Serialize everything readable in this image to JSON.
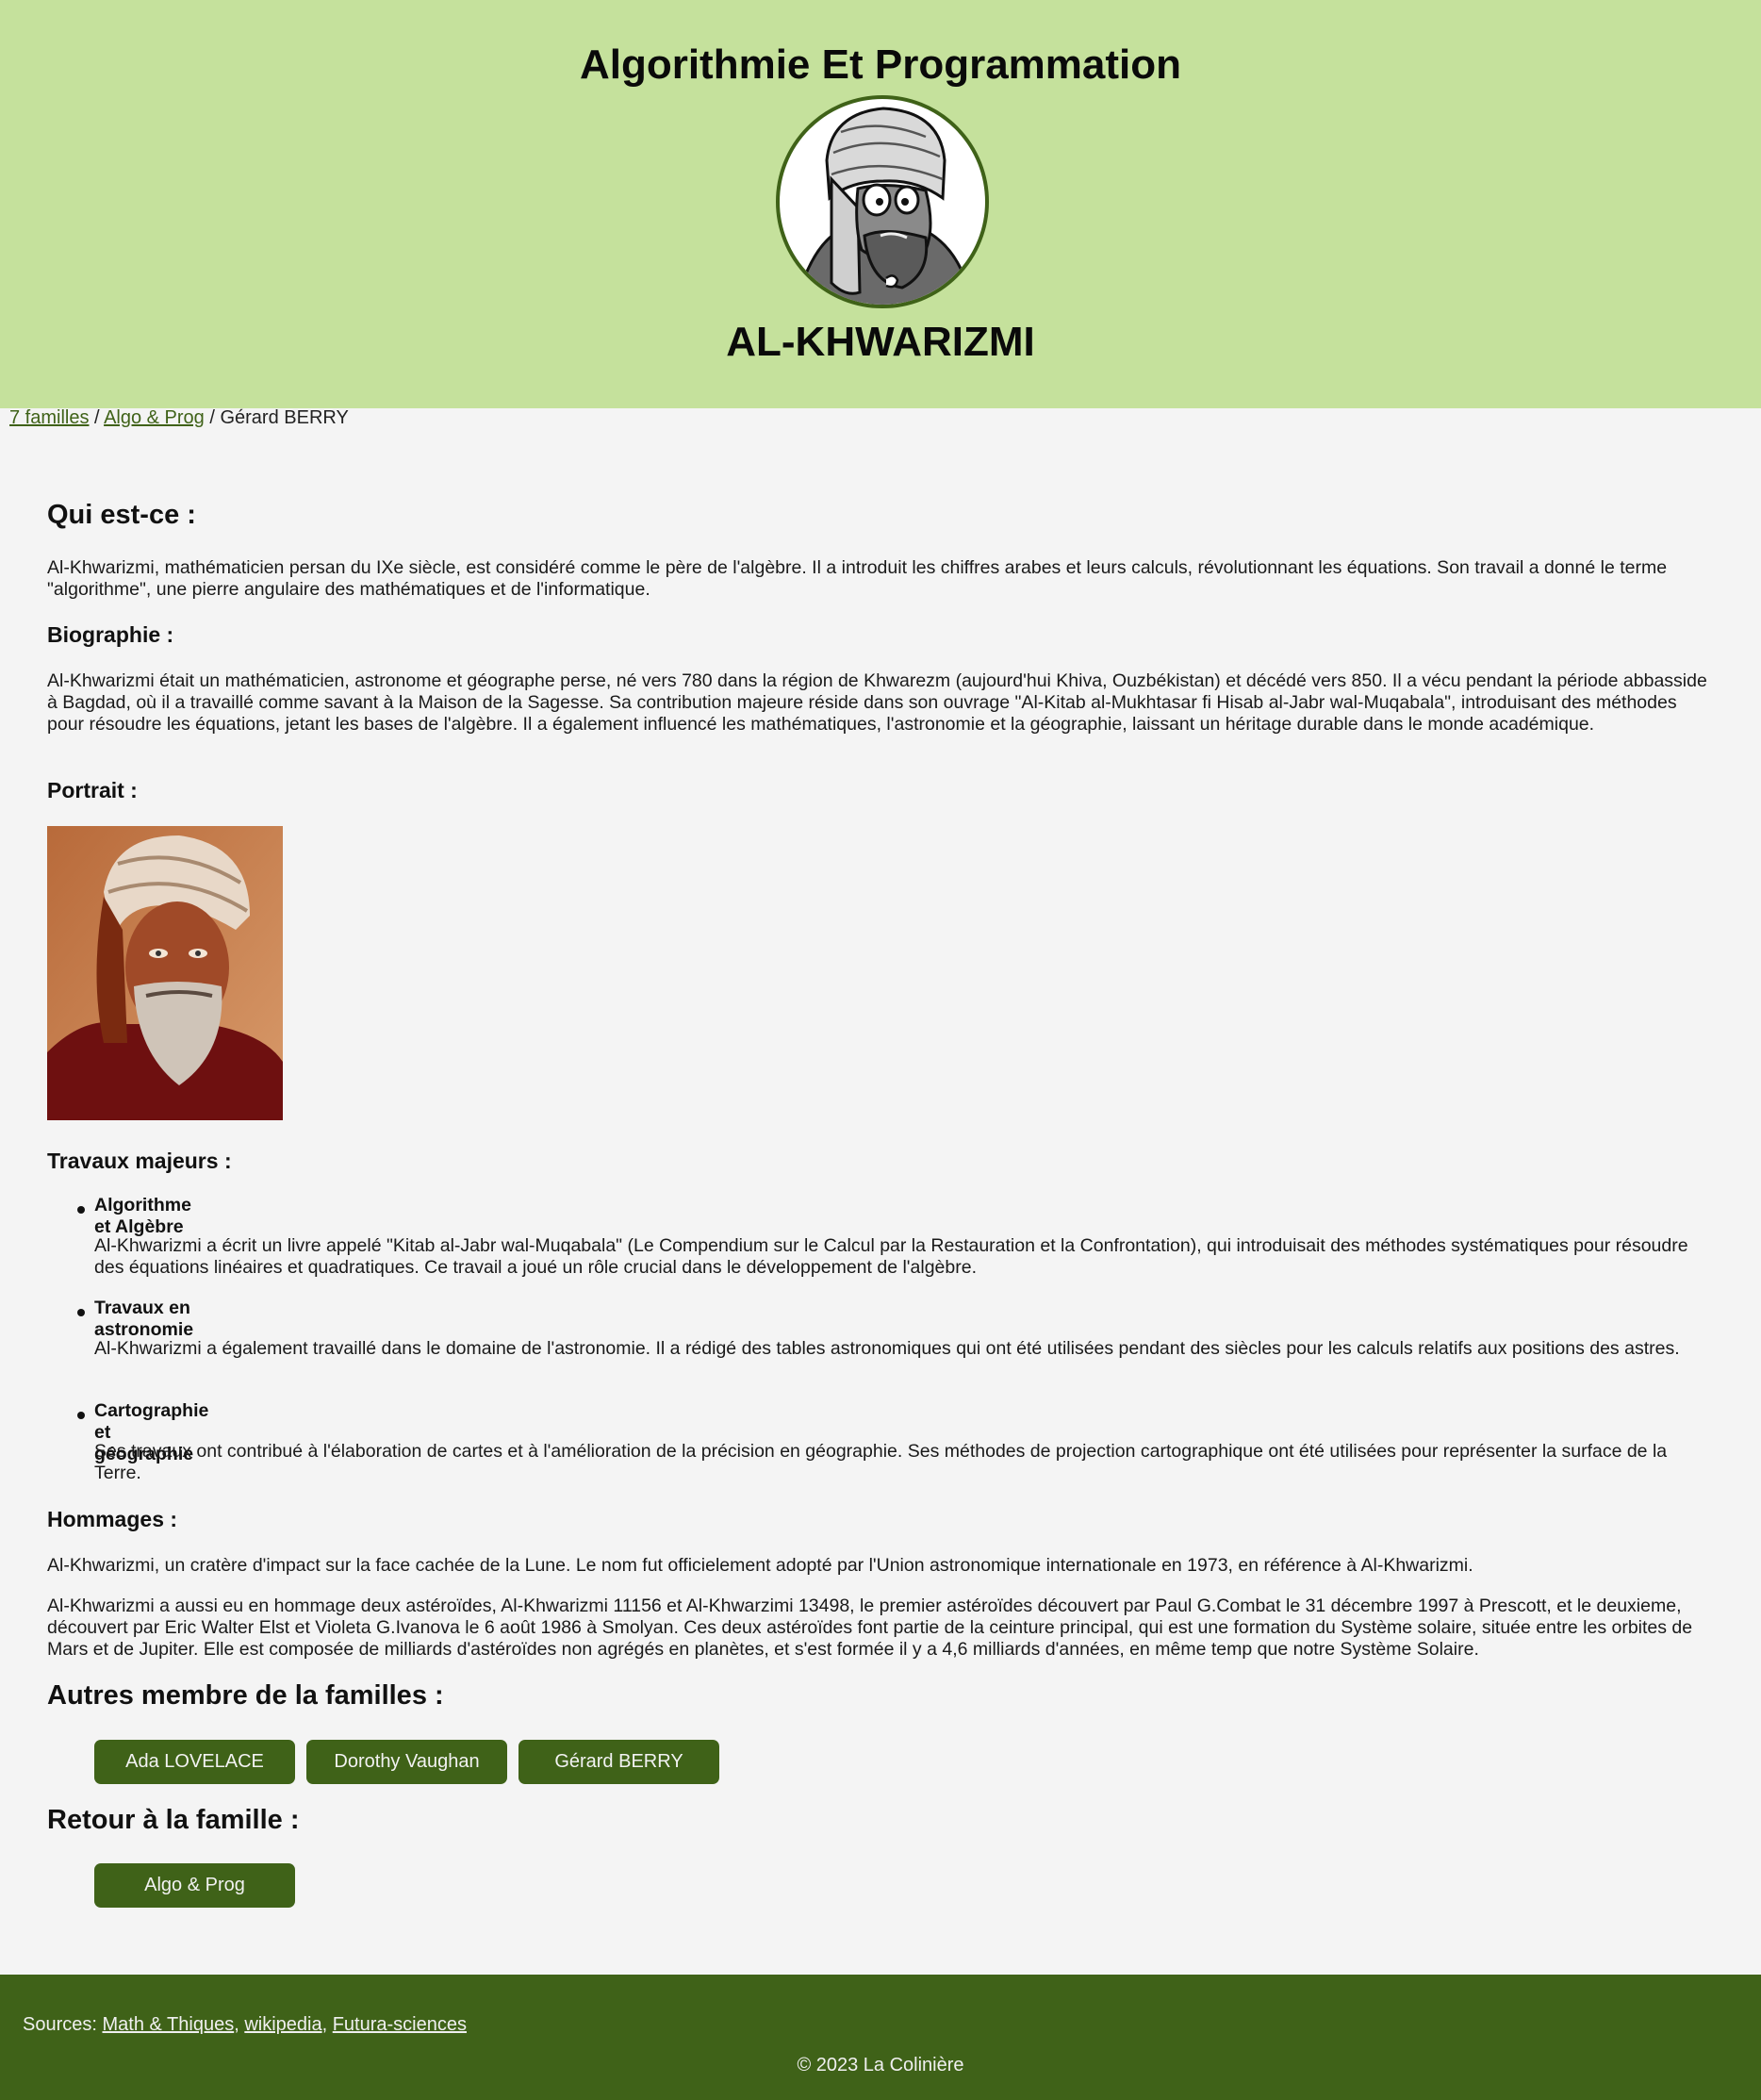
{
  "header": {
    "title": "Algorithmie Et Programmation",
    "avatar_icon": "cartoon-scholar-avatar",
    "name": "AL-KHWARIZMI"
  },
  "breadcrumb": {
    "link1": "7 familles",
    "sep": " / ",
    "link2": "Algo & Prog",
    "current": "Gérard BERRY"
  },
  "who": {
    "heading": "Qui est-ce :",
    "text": "Al-Khwarizmi, mathématicien persan du IXe siècle, est considéré comme le père de l'algèbre. Il a introduit les chiffres arabes et leurs calculs, révolutionnant les équations. Son travail a donné le terme \"algorithme\", une pierre angulaire des mathématiques et de l'informatique."
  },
  "bio": {
    "heading": "Biographie :",
    "text": "Al-Khwarizmi était un mathématicien, astronome et géographe perse, né vers 780 dans la région de Khwarezm (aujourd'hui Khiva, Ouzbékistan) et décédé vers 850. Il a vécu pendant la période abbasside à Bagdad, où il a travaillé comme savant à la Maison de la Sagesse. Sa contribution majeure réside dans son ouvrage \"Al-Kitab al-Mukhtasar fi Hisab al-Jabr wal-Muqabala\", introduisant des méthodes pour résoudre les équations, jetant les bases de l'algèbre. Il a également influencé les mathématiques, l'astronomie et la géographie, laissant un héritage durable dans le monde académique."
  },
  "portrait": {
    "heading": "Portrait :"
  },
  "works": {
    "heading": "Travaux majeurs :",
    "items": [
      {
        "title": "Algorithme et Algèbre",
        "desc": "Al-Khwarizmi a écrit un livre appelé \"Kitab al-Jabr wal-Muqabala\" (Le Compendium sur le Calcul par la Restauration et la Confrontation), qui introduisait des méthodes systématiques pour résoudre des équations linéaires et quadratiques. Ce travail a joué un rôle crucial dans le développement de l'algèbre."
      },
      {
        "title": "Travaux en astronomie",
        "desc": "Al-Khwarizmi a également travaillé dans le domaine de l'astronomie. Il a rédigé des tables astronomiques qui ont été utilisées pendant des siècles pour les calculs relatifs aux positions des astres."
      },
      {
        "title": "Cartographie et géographie",
        "desc": "Ses travaux ont contribué à l'élaboration de cartes et à l'amélioration de la précision en géographie. Ses méthodes de projection cartographique ont été utilisées pour représenter la surface de la Terre."
      }
    ]
  },
  "tributes": {
    "heading": "Hommages :",
    "text1": "Al-Khwarizmi, un cratère d'impact sur la face cachée de la Lune. Le nom fut officielement adopté par l'Union astronomique internationale en 1973, en référence à Al-Khwarizmi.",
    "text2": "Al-Khwarizmi a aussi eu en hommage deux astéroïdes, Al-Khwarizmi 11156 et Al-Khwarzimi 13498, le premier astéroïdes découvert par Paul G.Combat le 31 décembre 1997 à Prescott, et le deuxieme, découvert par Eric Walter Elst et Violeta G.Ivanova le 6 août 1986 à Smolyan. Ces deux astéroïdes font partie de la ceinture principal, qui est une formation du Système solaire, située entre les orbites de Mars et de Jupiter. Elle est composée de milliards d'astéroïdes non agrégés en planètes, et s'est formée il y a 4,6 milliards d'années, en même temp que notre Système Solaire."
  },
  "others": {
    "heading": "Autres membre de la familles :",
    "buttons": [
      "Ada LOVELACE",
      "Dorothy Vaughan",
      "Gérard BERRY"
    ]
  },
  "back": {
    "heading": "Retour à la famille :",
    "button": "Algo & Prog"
  },
  "footer": {
    "sources_label": "Sources: ",
    "source1": "Math & Thiques",
    "comma": ", ",
    "source2": "wikipedia",
    "source3": "Futura-sciences",
    "copyright": "© 2023 La Colinière"
  },
  "colors": {
    "header_bg": "#c5e19c",
    "accent": "#3f6218",
    "page_bg": "#f4f4f4"
  }
}
